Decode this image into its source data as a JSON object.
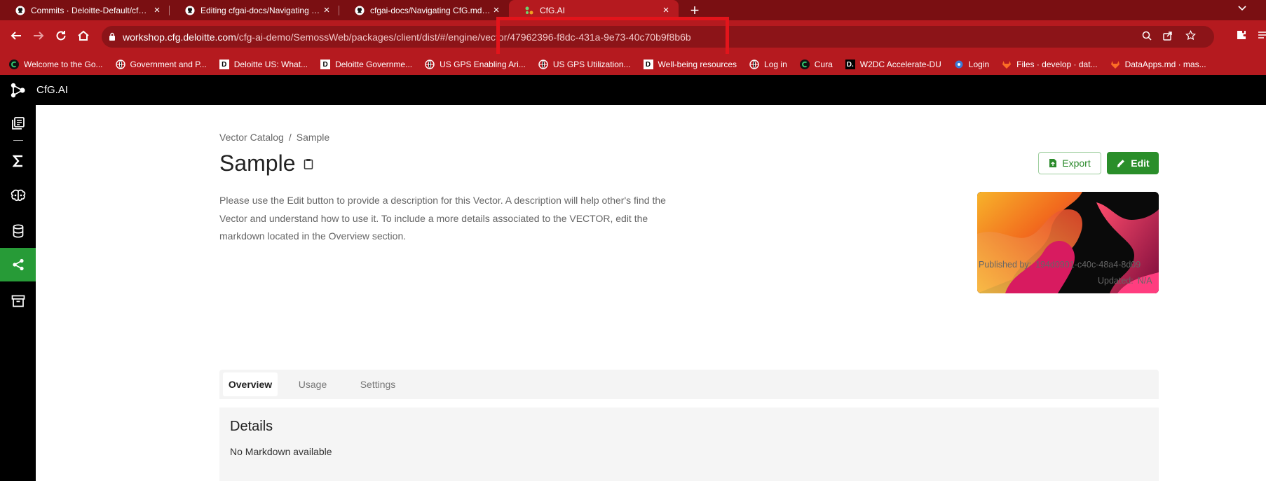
{
  "browser": {
    "tabs": [
      {
        "title": "Commits · Deloitte-Default/cfgai-docs",
        "active": false,
        "icon": "github-icon"
      },
      {
        "title": "Editing cfgai-docs/Navigating CfG.md",
        "active": false,
        "icon": "github-icon"
      },
      {
        "title": "cfgai-docs/Navigating CfG.md at main",
        "active": false,
        "icon": "github-icon"
      },
      {
        "title": "CfG.AI",
        "active": true,
        "icon": "cfg-icon"
      }
    ],
    "url_host": "workshop.cfg.deloitte.com",
    "url_path": "/cfg-ai-demo/SemossWeb/packages/client/dist/#/engine/vector/47962396-f8dc-431a-9e73-40c70b9f8b6b",
    "bookmarks": [
      {
        "label": "Welcome to the Go...",
        "icon": "c-logo-icon"
      },
      {
        "label": "Government and P...",
        "icon": "globe-icon"
      },
      {
        "label": "Deloitte US: What...",
        "icon": "d-logo-icon"
      },
      {
        "label": "Deloitte Governme...",
        "icon": "d-logo-icon"
      },
      {
        "label": "US GPS Enabling Ari...",
        "icon": "globe-icon"
      },
      {
        "label": "US GPS Utilization...",
        "icon": "globe-icon"
      },
      {
        "label": "Well-being resources",
        "icon": "d-logo-icon"
      },
      {
        "label": "Log in",
        "icon": "globe-icon"
      },
      {
        "label": "Cura",
        "icon": "c-logo-icon"
      },
      {
        "label": "W2DC Accelerate-DU",
        "icon": "d-logo-icon"
      },
      {
        "label": "Login",
        "icon": "gear-icon"
      },
      {
        "label": "Files · develop · dat...",
        "icon": "gitlab-icon"
      },
      {
        "label": "DataApps.md · mas...",
        "icon": "gitlab-icon"
      }
    ]
  },
  "app": {
    "name": "CfG.AI"
  },
  "sidebar": {
    "items": [
      {
        "name": "catalog-icon",
        "active": false
      },
      {
        "name": "sigma-icon",
        "active": false
      },
      {
        "name": "brain-icon",
        "active": false
      },
      {
        "name": "database-icon",
        "active": false
      },
      {
        "name": "vector-icon",
        "active": true
      },
      {
        "name": "archive-icon",
        "active": false
      }
    ]
  },
  "page": {
    "breadcrumb": [
      "Vector Catalog",
      "Sample"
    ],
    "breadcrumb_sep": "/",
    "title": "Sample",
    "description": "Please use the Edit button to provide a description for this Vector. A description will help other's find the Vector and understand how to use it. To include a more details associated to the VECTOR, edit the markdown located in the Overview section.",
    "export_label": "Export",
    "edit_label": "Edit",
    "published_by_label": "Published by:",
    "published_by_value": "194d0901-c40c-48a4-8d09",
    "updated_label": "Updated:",
    "updated_value": "N/A",
    "tabs": [
      "Overview",
      "Usage",
      "Settings"
    ],
    "selected_tab": "Overview",
    "details_title": "Details",
    "details_body": "No Markdown available"
  },
  "colors": {
    "chrome_dark": "#7a0f12",
    "chrome": "#b51a1f",
    "accent_green": "#279b37",
    "highlight_red": "#e3141b"
  }
}
